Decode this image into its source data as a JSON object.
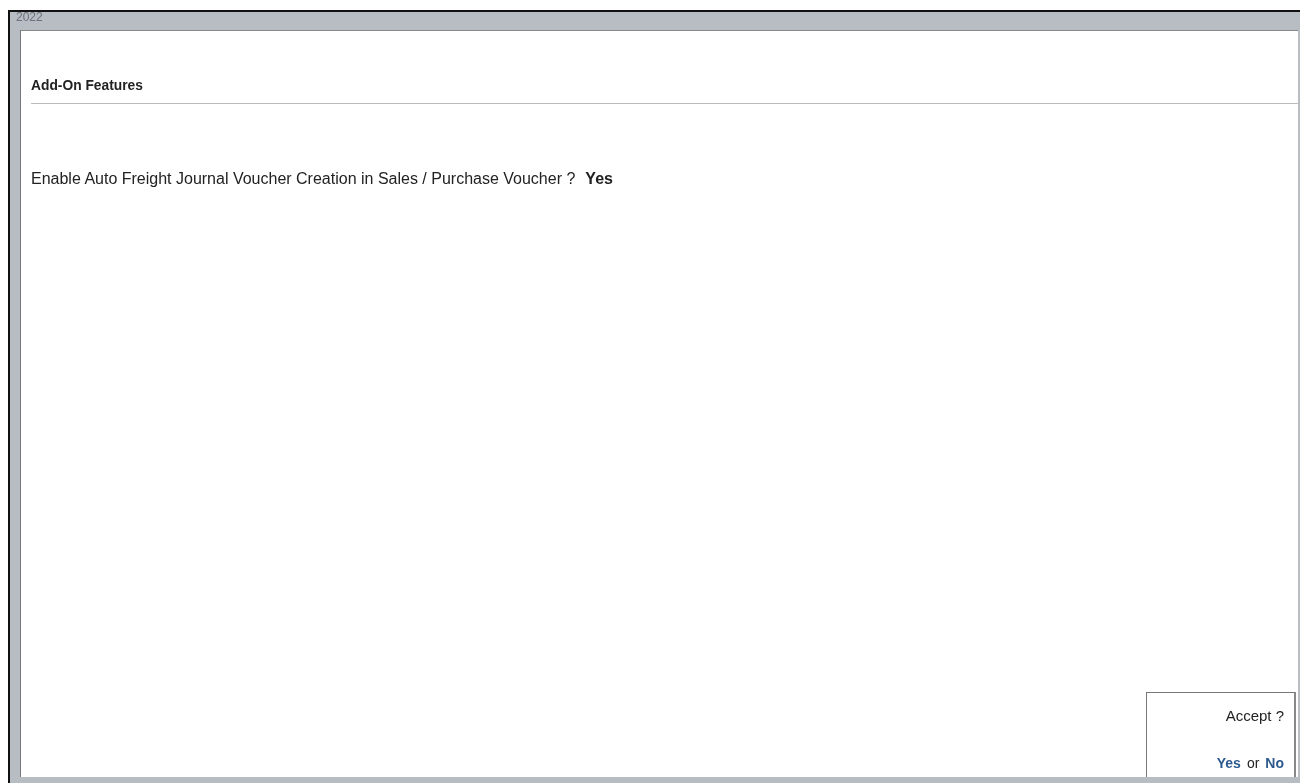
{
  "background_text": "2022",
  "panel": {
    "title": "Add-On Features",
    "fields": [
      {
        "label": "Enable Auto Freight Journal Voucher Creation in Sales / Purchase Voucher ?",
        "value": "Yes"
      }
    ]
  },
  "accept_dialog": {
    "question": "Accept ?",
    "yes": "Yes",
    "separator": "or",
    "no": "No"
  }
}
